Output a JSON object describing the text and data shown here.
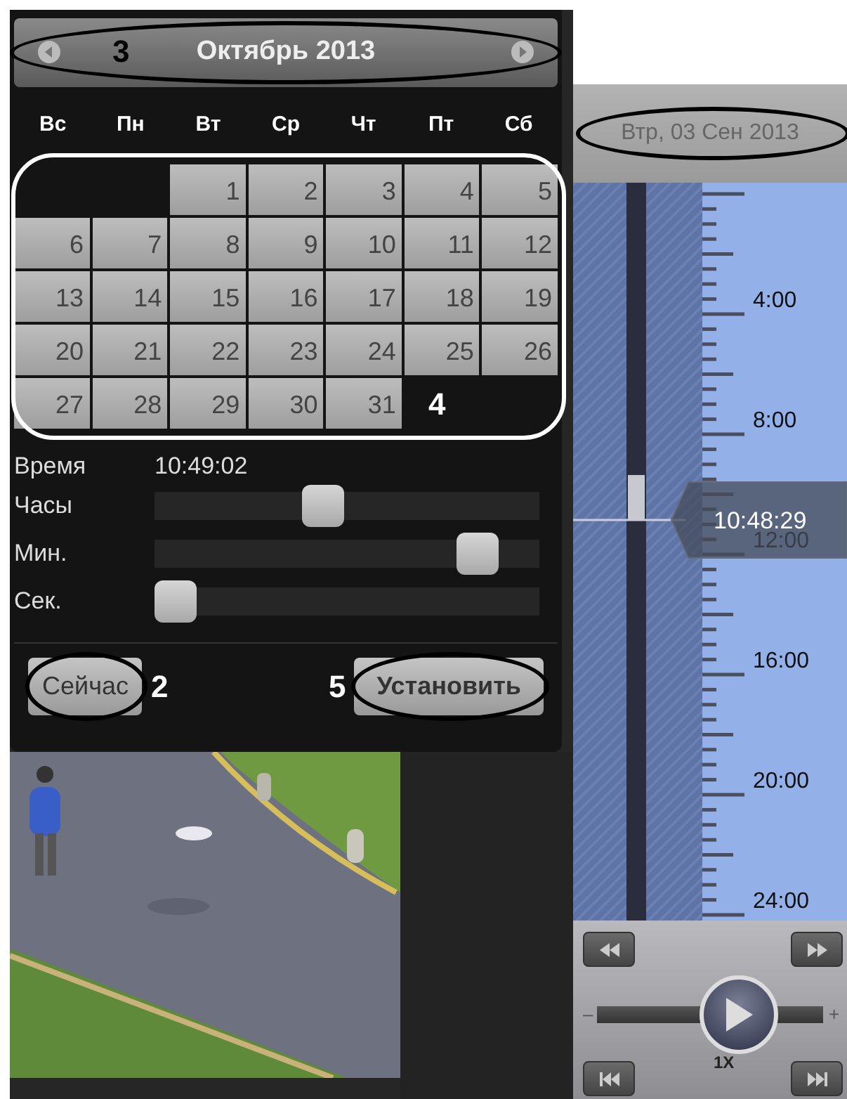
{
  "calendar": {
    "month_title": "Октябрь 2013",
    "circled": true,
    "callout": "3",
    "weekdays": [
      "Вс",
      "Пн",
      "Вт",
      "Ср",
      "Чт",
      "Пт",
      "Сб"
    ],
    "grid_circled": true,
    "grid_callout": "4",
    "weeks": [
      [
        {
          "kind": "empty"
        },
        {
          "kind": "empty"
        },
        {
          "kind": "day",
          "label": "1"
        },
        {
          "kind": "day",
          "label": "2"
        },
        {
          "kind": "day",
          "label": "3"
        },
        {
          "kind": "day",
          "label": "4"
        },
        {
          "kind": "day",
          "label": "5"
        }
      ],
      [
        {
          "kind": "day",
          "label": "6"
        },
        {
          "kind": "day",
          "label": "7"
        },
        {
          "kind": "day",
          "label": "8"
        },
        {
          "kind": "day",
          "label": "9"
        },
        {
          "kind": "day",
          "label": "10"
        },
        {
          "kind": "day",
          "label": "11"
        },
        {
          "kind": "day",
          "label": "12"
        }
      ],
      [
        {
          "kind": "day",
          "label": "13"
        },
        {
          "kind": "day",
          "label": "14"
        },
        {
          "kind": "day",
          "label": "15"
        },
        {
          "kind": "day",
          "label": "16"
        },
        {
          "kind": "day",
          "label": "17"
        },
        {
          "kind": "day",
          "label": "18"
        },
        {
          "kind": "day",
          "label": "19"
        }
      ],
      [
        {
          "kind": "day",
          "label": "20"
        },
        {
          "kind": "day",
          "label": "21"
        },
        {
          "kind": "day",
          "label": "22"
        },
        {
          "kind": "day",
          "label": "23"
        },
        {
          "kind": "day",
          "label": "24"
        },
        {
          "kind": "day",
          "label": "25"
        },
        {
          "kind": "day",
          "label": "26"
        }
      ],
      [
        {
          "kind": "day",
          "label": "27"
        },
        {
          "kind": "day",
          "label": "28"
        },
        {
          "kind": "day",
          "label": "29"
        },
        {
          "kind": "day",
          "label": "30"
        },
        {
          "kind": "day",
          "label": "31"
        },
        {
          "kind": "empty"
        },
        {
          "kind": "empty"
        }
      ]
    ],
    "time": {
      "label": "Время",
      "value": "10:49:02"
    },
    "sliders": [
      {
        "label": "Часы",
        "level": 0.43
      },
      {
        "label": "Мин.",
        "level": 0.88
      },
      {
        "label": "Сек.",
        "level": 0
      }
    ],
    "footer": [
      {
        "kind": "button",
        "label": "Сейчас",
        "circled": true
      },
      {
        "kind": "callout",
        "label": "2"
      },
      {
        "kind": "callout",
        "label": "5"
      },
      {
        "kind": "button",
        "label": "Установить",
        "circled": true
      }
    ]
  },
  "timeline": {
    "date": "Втр, 03 Сен 2013",
    "date_circled": true,
    "hour_labels": [
      "4:00",
      "8:00",
      "12:00",
      "16:00",
      "20:00",
      "24:00"
    ],
    "cursor_time": "10:48:29"
  },
  "player": {
    "speed_min": "–",
    "speed_max": "+",
    "speed_label": "1X",
    "speed_slider": {
      "level": 0.63
    }
  }
}
